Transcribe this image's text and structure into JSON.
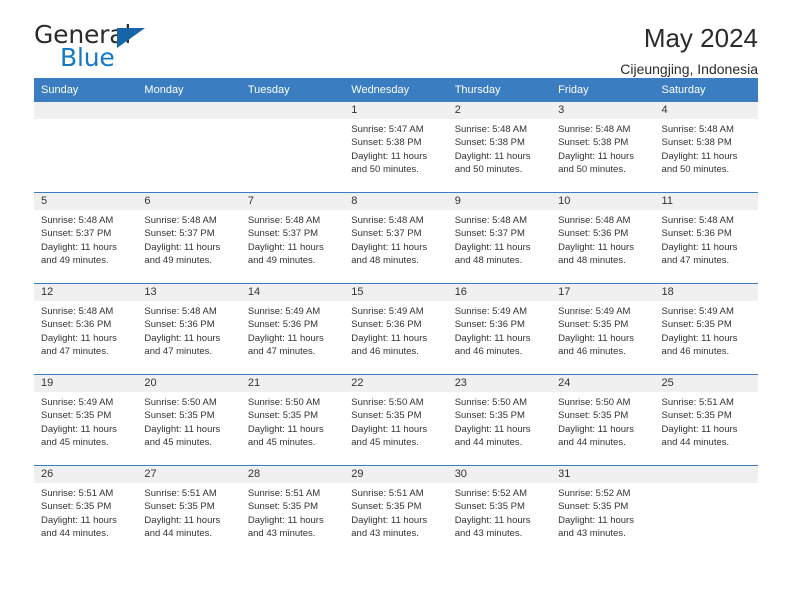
{
  "brand": {
    "name_primary": "General",
    "name_secondary": "Blue",
    "triangle_color": "#1565a8",
    "accent_color": "#1479c4"
  },
  "header": {
    "title": "May 2024",
    "subtitle": "Cijeungjing, Indonesia"
  },
  "theme": {
    "header_row_bg": "#3a7dc0",
    "daynum_bg": "#f0f0f0",
    "grid_line": "#3a7dc0",
    "text": "#333333"
  },
  "labels": {
    "sunrise_prefix": "Sunrise:",
    "sunset_prefix": "Sunset:",
    "daylight_prefix": "Daylight:"
  },
  "weekdays": [
    "Sunday",
    "Monday",
    "Tuesday",
    "Wednesday",
    "Thursday",
    "Friday",
    "Saturday"
  ],
  "weeks": [
    [
      {
        "day": "",
        "sunrise": "",
        "sunset": "",
        "daylight_line1": "",
        "daylight_line2": ""
      },
      {
        "day": "",
        "sunrise": "",
        "sunset": "",
        "daylight_line1": "",
        "daylight_line2": ""
      },
      {
        "day": "",
        "sunrise": "",
        "sunset": "",
        "daylight_line1": "",
        "daylight_line2": ""
      },
      {
        "day": "1",
        "sunrise": "Sunrise: 5:47 AM",
        "sunset": "Sunset: 5:38 PM",
        "daylight_line1": "Daylight: 11 hours",
        "daylight_line2": "and 50 minutes."
      },
      {
        "day": "2",
        "sunrise": "Sunrise: 5:48 AM",
        "sunset": "Sunset: 5:38 PM",
        "daylight_line1": "Daylight: 11 hours",
        "daylight_line2": "and 50 minutes."
      },
      {
        "day": "3",
        "sunrise": "Sunrise: 5:48 AM",
        "sunset": "Sunset: 5:38 PM",
        "daylight_line1": "Daylight: 11 hours",
        "daylight_line2": "and 50 minutes."
      },
      {
        "day": "4",
        "sunrise": "Sunrise: 5:48 AM",
        "sunset": "Sunset: 5:38 PM",
        "daylight_line1": "Daylight: 11 hours",
        "daylight_line2": "and 50 minutes."
      }
    ],
    [
      {
        "day": "5",
        "sunrise": "Sunrise: 5:48 AM",
        "sunset": "Sunset: 5:37 PM",
        "daylight_line1": "Daylight: 11 hours",
        "daylight_line2": "and 49 minutes."
      },
      {
        "day": "6",
        "sunrise": "Sunrise: 5:48 AM",
        "sunset": "Sunset: 5:37 PM",
        "daylight_line1": "Daylight: 11 hours",
        "daylight_line2": "and 49 minutes."
      },
      {
        "day": "7",
        "sunrise": "Sunrise: 5:48 AM",
        "sunset": "Sunset: 5:37 PM",
        "daylight_line1": "Daylight: 11 hours",
        "daylight_line2": "and 49 minutes."
      },
      {
        "day": "8",
        "sunrise": "Sunrise: 5:48 AM",
        "sunset": "Sunset: 5:37 PM",
        "daylight_line1": "Daylight: 11 hours",
        "daylight_line2": "and 48 minutes."
      },
      {
        "day": "9",
        "sunrise": "Sunrise: 5:48 AM",
        "sunset": "Sunset: 5:37 PM",
        "daylight_line1": "Daylight: 11 hours",
        "daylight_line2": "and 48 minutes."
      },
      {
        "day": "10",
        "sunrise": "Sunrise: 5:48 AM",
        "sunset": "Sunset: 5:36 PM",
        "daylight_line1": "Daylight: 11 hours",
        "daylight_line2": "and 48 minutes."
      },
      {
        "day": "11",
        "sunrise": "Sunrise: 5:48 AM",
        "sunset": "Sunset: 5:36 PM",
        "daylight_line1": "Daylight: 11 hours",
        "daylight_line2": "and 47 minutes."
      }
    ],
    [
      {
        "day": "12",
        "sunrise": "Sunrise: 5:48 AM",
        "sunset": "Sunset: 5:36 PM",
        "daylight_line1": "Daylight: 11 hours",
        "daylight_line2": "and 47 minutes."
      },
      {
        "day": "13",
        "sunrise": "Sunrise: 5:48 AM",
        "sunset": "Sunset: 5:36 PM",
        "daylight_line1": "Daylight: 11 hours",
        "daylight_line2": "and 47 minutes."
      },
      {
        "day": "14",
        "sunrise": "Sunrise: 5:49 AM",
        "sunset": "Sunset: 5:36 PM",
        "daylight_line1": "Daylight: 11 hours",
        "daylight_line2": "and 47 minutes."
      },
      {
        "day": "15",
        "sunrise": "Sunrise: 5:49 AM",
        "sunset": "Sunset: 5:36 PM",
        "daylight_line1": "Daylight: 11 hours",
        "daylight_line2": "and 46 minutes."
      },
      {
        "day": "16",
        "sunrise": "Sunrise: 5:49 AM",
        "sunset": "Sunset: 5:36 PM",
        "daylight_line1": "Daylight: 11 hours",
        "daylight_line2": "and 46 minutes."
      },
      {
        "day": "17",
        "sunrise": "Sunrise: 5:49 AM",
        "sunset": "Sunset: 5:35 PM",
        "daylight_line1": "Daylight: 11 hours",
        "daylight_line2": "and 46 minutes."
      },
      {
        "day": "18",
        "sunrise": "Sunrise: 5:49 AM",
        "sunset": "Sunset: 5:35 PM",
        "daylight_line1": "Daylight: 11 hours",
        "daylight_line2": "and 46 minutes."
      }
    ],
    [
      {
        "day": "19",
        "sunrise": "Sunrise: 5:49 AM",
        "sunset": "Sunset: 5:35 PM",
        "daylight_line1": "Daylight: 11 hours",
        "daylight_line2": "and 45 minutes."
      },
      {
        "day": "20",
        "sunrise": "Sunrise: 5:50 AM",
        "sunset": "Sunset: 5:35 PM",
        "daylight_line1": "Daylight: 11 hours",
        "daylight_line2": "and 45 minutes."
      },
      {
        "day": "21",
        "sunrise": "Sunrise: 5:50 AM",
        "sunset": "Sunset: 5:35 PM",
        "daylight_line1": "Daylight: 11 hours",
        "daylight_line2": "and 45 minutes."
      },
      {
        "day": "22",
        "sunrise": "Sunrise: 5:50 AM",
        "sunset": "Sunset: 5:35 PM",
        "daylight_line1": "Daylight: 11 hours",
        "daylight_line2": "and 45 minutes."
      },
      {
        "day": "23",
        "sunrise": "Sunrise: 5:50 AM",
        "sunset": "Sunset: 5:35 PM",
        "daylight_line1": "Daylight: 11 hours",
        "daylight_line2": "and 44 minutes."
      },
      {
        "day": "24",
        "sunrise": "Sunrise: 5:50 AM",
        "sunset": "Sunset: 5:35 PM",
        "daylight_line1": "Daylight: 11 hours",
        "daylight_line2": "and 44 minutes."
      },
      {
        "day": "25",
        "sunrise": "Sunrise: 5:51 AM",
        "sunset": "Sunset: 5:35 PM",
        "daylight_line1": "Daylight: 11 hours",
        "daylight_line2": "and 44 minutes."
      }
    ],
    [
      {
        "day": "26",
        "sunrise": "Sunrise: 5:51 AM",
        "sunset": "Sunset: 5:35 PM",
        "daylight_line1": "Daylight: 11 hours",
        "daylight_line2": "and 44 minutes."
      },
      {
        "day": "27",
        "sunrise": "Sunrise: 5:51 AM",
        "sunset": "Sunset: 5:35 PM",
        "daylight_line1": "Daylight: 11 hours",
        "daylight_line2": "and 44 minutes."
      },
      {
        "day": "28",
        "sunrise": "Sunrise: 5:51 AM",
        "sunset": "Sunset: 5:35 PM",
        "daylight_line1": "Daylight: 11 hours",
        "daylight_line2": "and 43 minutes."
      },
      {
        "day": "29",
        "sunrise": "Sunrise: 5:51 AM",
        "sunset": "Sunset: 5:35 PM",
        "daylight_line1": "Daylight: 11 hours",
        "daylight_line2": "and 43 minutes."
      },
      {
        "day": "30",
        "sunrise": "Sunrise: 5:52 AM",
        "sunset": "Sunset: 5:35 PM",
        "daylight_line1": "Daylight: 11 hours",
        "daylight_line2": "and 43 minutes."
      },
      {
        "day": "31",
        "sunrise": "Sunrise: 5:52 AM",
        "sunset": "Sunset: 5:35 PM",
        "daylight_line1": "Daylight: 11 hours",
        "daylight_line2": "and 43 minutes."
      },
      {
        "day": "",
        "sunrise": "",
        "sunset": "",
        "daylight_line1": "",
        "daylight_line2": ""
      }
    ]
  ]
}
